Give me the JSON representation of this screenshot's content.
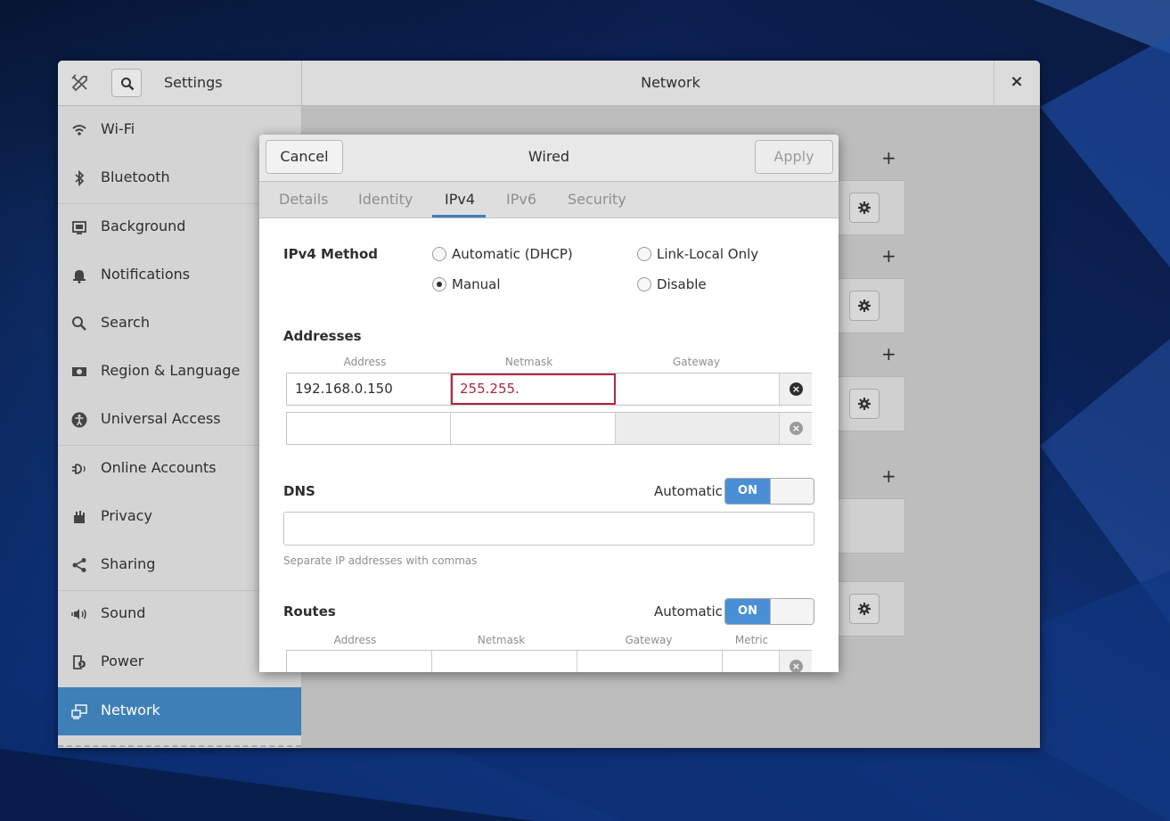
{
  "window": {
    "settings_title": "Settings",
    "panel_title": "Network",
    "close_glyph": "×",
    "search_icon": "search-icon",
    "tools_icon": "tools-icon"
  },
  "sidebar": {
    "items": [
      {
        "label": "Wi-Fi",
        "icon": "wifi-icon"
      },
      {
        "label": "Bluetooth",
        "icon": "bluetooth-icon"
      },
      {
        "label": "Background",
        "icon": "background-icon"
      },
      {
        "label": "Notifications",
        "icon": "bell-icon"
      },
      {
        "label": "Search",
        "icon": "search-icon"
      },
      {
        "label": "Region & Language",
        "icon": "flag-icon"
      },
      {
        "label": "Universal Access",
        "icon": "accessibility-icon"
      },
      {
        "label": "Online Accounts",
        "icon": "online-accounts-icon"
      },
      {
        "label": "Privacy",
        "icon": "hand-icon"
      },
      {
        "label": "Sharing",
        "icon": "share-icon"
      },
      {
        "label": "Sound",
        "icon": "speaker-icon"
      },
      {
        "label": "Power",
        "icon": "power-icon"
      },
      {
        "label": "Network",
        "icon": "network-icon",
        "active": true
      }
    ],
    "active_color": "#3f7fb8"
  },
  "main": {
    "add_glyph": "+"
  },
  "dialog": {
    "title": "Wired",
    "cancel_label": "Cancel",
    "apply_label": "Apply",
    "tabs": [
      {
        "label": "Details"
      },
      {
        "label": "Identity"
      },
      {
        "label": "IPv4",
        "active": true
      },
      {
        "label": "IPv6"
      },
      {
        "label": "Security"
      }
    ],
    "ipv4_method": {
      "label": "IPv4 Method",
      "options": [
        {
          "label": "Automatic (DHCP)",
          "checked": false
        },
        {
          "label": "Link-Local Only",
          "checked": false
        },
        {
          "label": "Manual",
          "checked": true
        },
        {
          "label": "Disable",
          "checked": false
        }
      ]
    },
    "addresses": {
      "heading": "Addresses",
      "columns": [
        "Address",
        "Netmask",
        "Gateway"
      ],
      "rows": [
        {
          "address": "192.168.0.150",
          "netmask": "255.255.",
          "gateway": ""
        },
        {
          "address": "",
          "netmask": "",
          "gateway": ""
        }
      ]
    },
    "dns": {
      "heading": "DNS",
      "automatic_label": "Automatic",
      "switch_label": "ON",
      "value": "",
      "hint": "Separate IP addresses with commas"
    },
    "routes": {
      "heading": "Routes",
      "automatic_label": "Automatic",
      "switch_label": "ON",
      "columns": [
        "Address",
        "Netmask",
        "Gateway",
        "Metric"
      ]
    },
    "colors": {
      "accent": "#4a8fd6",
      "error": "#b0283a"
    }
  }
}
